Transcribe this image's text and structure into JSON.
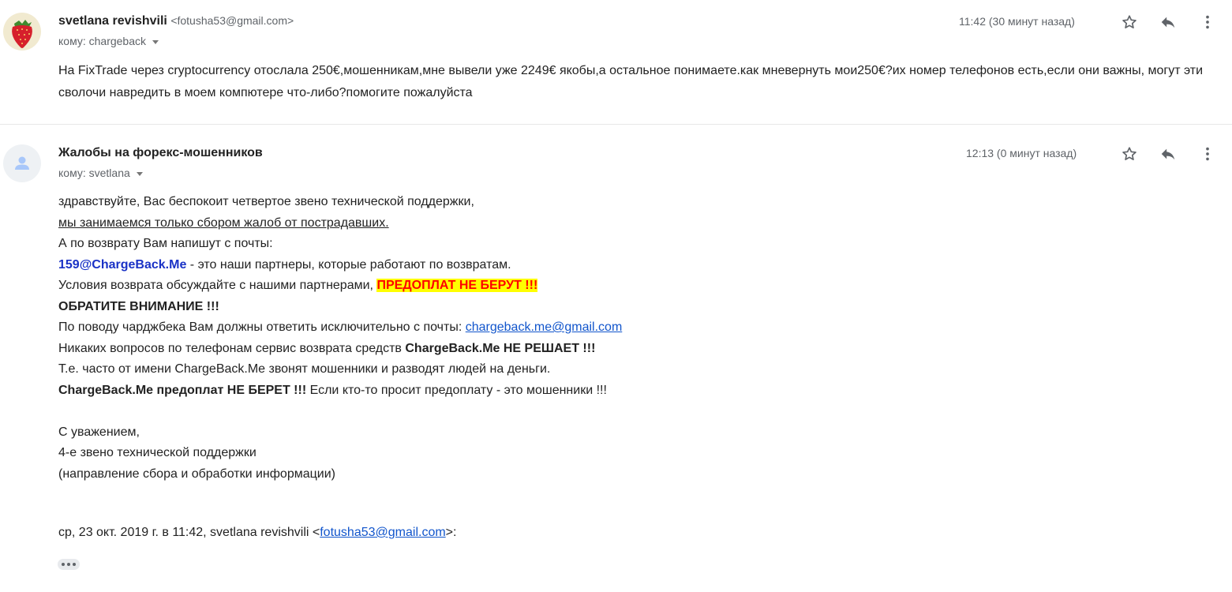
{
  "message1": {
    "sender_name": "svetlana revishvili",
    "sender_email": "<fotusha53@gmail.com>",
    "to_label": "кому: chargeback",
    "time": "11:42 (30 минут назад)",
    "body": "На FixTrade через cryptocurrency отослала 250€,мошенникам,мне вывели уже 2249€ якобы,а остальное понимаете.как мневернуть  мои250€?их номер телефонов есть,если они важны, могут эти сволочи навредить в моем компютере что-либо?помогите пожалуйста"
  },
  "message2": {
    "sender_name": "Жалобы на форекс-мошенников",
    "to_label": "кому: svetlana",
    "time": "12:13 (0 минут назад)",
    "lines": {
      "l1": "здравствуйте, Вас беспокоит четвертое звено технической поддержки,",
      "l2": "мы занимаемся только сбором жалоб от пострадавших.",
      "l3": "А по возврату Вам напишут с почты:",
      "l4_email": "159@ChargeBack.Me",
      "l4_rest": " - это наши партнеры, которые работают по возвратам.",
      "l5_text": "Условия возврата обсуждайте с нашими партнерами, ",
      "l5_highlight": "ПРЕДОПЛАТ НЕ БЕРУТ !!!",
      "l6": "ОБРАТИТЕ ВНИМАНИЕ !!!",
      "l7_text": "По поводу чарджбека Вам должны ответить исключительно с почты: ",
      "l7_link": "chargeback.me@gmail.com",
      "l8_text": "Никаких вопросов по телефонам сервис возврата средств ",
      "l8_bold": "ChargeBack.Me НЕ РЕШАЕТ !!!",
      "l9": "Т.е. часто от имени ChargeBack.Me звонят мошенники и разводят людей на деньги.",
      "l10_bold": "ChargeBack.Me предоплат НЕ БЕРЕТ !!!",
      "l10_rest": " Если кто-то просит предоплату - это мошенники !!!",
      "sig1": "С уважением,",
      "sig2": "4-е звено технической поддержки",
      "sig3": "(направление сбора и обработки информации)"
    },
    "quote_prefix": "ср, 23 окт. 2019 г. в 11:42, svetlana revishvili <",
    "quote_email": "fotusha53@gmail.com",
    "quote_suffix": ">:"
  },
  "icons": {
    "star": "star-icon",
    "reply": "reply-icon",
    "more": "more-vert-icon",
    "avatar_default": "person-icon",
    "show_trimmed": "ellipsis-icon"
  },
  "colors": {
    "highlight_bg": "#ffff00",
    "highlight_text": "#ff0000",
    "link": "#1155cc",
    "partner_email": "#1a32c6"
  }
}
